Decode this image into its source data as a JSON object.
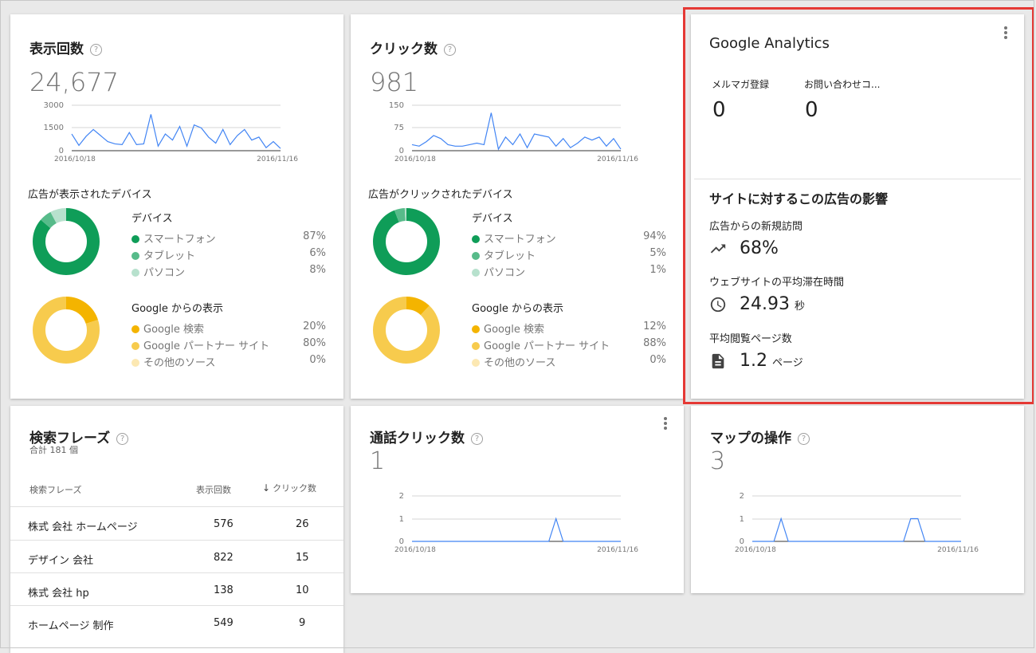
{
  "cards": {
    "impressions": {
      "title": "表示回数",
      "help": "?",
      "value": "24,677",
      "chart_y_ticks": [
        "3000",
        "1500",
        "0"
      ],
      "chart_x_start": "2016/10/18",
      "chart_x_end": "2016/11/16",
      "devices_heading": "広告が表示されたデバイス",
      "devices_legend_title": "デバイス",
      "devices": [
        {
          "label": "スマートフォン",
          "pct": "87%",
          "color": "#0f9d58"
        },
        {
          "label": "タブレット",
          "pct": "6%",
          "color": "#57bb8a"
        },
        {
          "label": "パソコン",
          "pct": "8%",
          "color": "#b7e1cd"
        }
      ],
      "sources_legend_title": "Google からの表示",
      "sources": [
        {
          "label": "Google 検索",
          "pct": "20%",
          "color": "#f4b400"
        },
        {
          "label": "Google パートナー サイト",
          "pct": "80%",
          "color": "#f7cb4d"
        },
        {
          "label": "その他のソース",
          "pct": "0%",
          "color": "#fce8b2"
        }
      ]
    },
    "clicks": {
      "title": "クリック数",
      "help": "?",
      "value": "981",
      "chart_y_ticks": [
        "150",
        "75",
        "0"
      ],
      "chart_x_start": "2016/10/18",
      "chart_x_end": "2016/11/16",
      "devices_heading": "広告がクリックされたデバイス",
      "devices_legend_title": "デバイス",
      "devices": [
        {
          "label": "スマートフォン",
          "pct": "94%",
          "color": "#0f9d58"
        },
        {
          "label": "タブレット",
          "pct": "5%",
          "color": "#57bb8a"
        },
        {
          "label": "パソコン",
          "pct": "1%",
          "color": "#b7e1cd"
        }
      ],
      "sources_legend_title": "Google からの表示",
      "sources": [
        {
          "label": "Google 検索",
          "pct": "12%",
          "color": "#f4b400"
        },
        {
          "label": "Google パートナー サイト",
          "pct": "88%",
          "color": "#f7cb4d"
        },
        {
          "label": "その他のソース",
          "pct": "0%",
          "color": "#fce8b2"
        }
      ]
    },
    "analytics": {
      "title": "Google Analytics",
      "goals": [
        {
          "label": "メルマガ登録",
          "value": "0"
        },
        {
          "label": "お問い合わせコ...",
          "value": "0"
        }
      ],
      "impact_heading": "サイトに対するこの広告の影響",
      "new_visits_label": "広告からの新規訪問",
      "new_visits_value": "68%",
      "avg_time_label": "ウェブサイトの平均滞在時間",
      "avg_time_value": "24.93",
      "avg_time_unit": "秒",
      "pages_label": "平均閲覧ページ数",
      "pages_value": "1.2",
      "pages_unit": "ページ"
    },
    "keywords": {
      "title": "検索フレーズ",
      "help": "?",
      "total": "合計 181 個",
      "col_phrase": "検索フレーズ",
      "col_impr": "表示回数",
      "col_clicks": "クリック数",
      "sort_arrow": "↓",
      "rows": [
        {
          "phrase": "株式 会社 ホームページ",
          "impr": "576",
          "clicks": "26"
        },
        {
          "phrase": "デザイン 会社",
          "impr": "822",
          "clicks": "15"
        },
        {
          "phrase": "株式 会社 hp",
          "impr": "138",
          "clicks": "10"
        },
        {
          "phrase": "ホームページ 制作",
          "impr": "549",
          "clicks": "9"
        }
      ]
    },
    "calls": {
      "title": "通話クリック数",
      "help": "?",
      "value": "1",
      "chart_y_ticks": [
        "2",
        "1",
        "0"
      ],
      "chart_x_start": "2016/10/18",
      "chart_x_end": "2016/11/16"
    },
    "maps": {
      "title": "マップの操作",
      "help": "?",
      "value": "3",
      "chart_y_ticks": [
        "2",
        "1",
        "0"
      ],
      "chart_x_start": "2016/10/18",
      "chart_x_end": "2016/11/16"
    }
  },
  "chart_data": [
    {
      "type": "line",
      "x_start": "2016/10/18",
      "x_end": "2016/11/16",
      "ylim": [
        0,
        3000
      ],
      "series": [
        {
          "values": [
            1100,
            350,
            950,
            1400,
            1000,
            600,
            450,
            400,
            1200,
            400,
            450,
            2400,
            300,
            1100,
            700,
            1600,
            300,
            1700,
            1500,
            900,
            500,
            1400,
            400,
            1000,
            1400,
            700,
            900,
            200,
            600,
            150
          ]
        }
      ]
    },
    {
      "type": "line",
      "x_start": "2016/10/18",
      "x_end": "2016/11/16",
      "ylim": [
        0,
        150
      ],
      "series": [
        {
          "values": [
            20,
            15,
            30,
            50,
            40,
            20,
            15,
            15,
            20,
            25,
            20,
            125,
            5,
            45,
            20,
            55,
            10,
            55,
            50,
            45,
            15,
            40,
            10,
            25,
            45,
            35,
            45,
            15,
            40,
            5
          ]
        }
      ]
    },
    {
      "type": "line",
      "x_start": "2016/10/18",
      "x_end": "2016/11/16",
      "ylim": [
        0,
        2
      ],
      "series": [
        {
          "values": [
            0,
            0,
            0,
            0,
            0,
            0,
            0,
            0,
            0,
            0,
            0,
            0,
            0,
            0,
            0,
            0,
            0,
            0,
            0,
            0,
            1,
            0,
            0,
            0,
            0,
            0,
            0,
            0,
            0,
            0
          ]
        }
      ]
    },
    {
      "type": "line",
      "x_start": "2016/10/18",
      "x_end": "2016/11/16",
      "ylim": [
        0,
        2
      ],
      "series": [
        {
          "values": [
            0,
            0,
            0,
            0,
            1,
            0,
            0,
            0,
            0,
            0,
            0,
            0,
            0,
            0,
            0,
            0,
            0,
            0,
            0,
            0,
            0,
            0,
            1,
            1,
            0,
            0,
            0,
            0,
            0,
            0
          ]
        }
      ]
    }
  ]
}
